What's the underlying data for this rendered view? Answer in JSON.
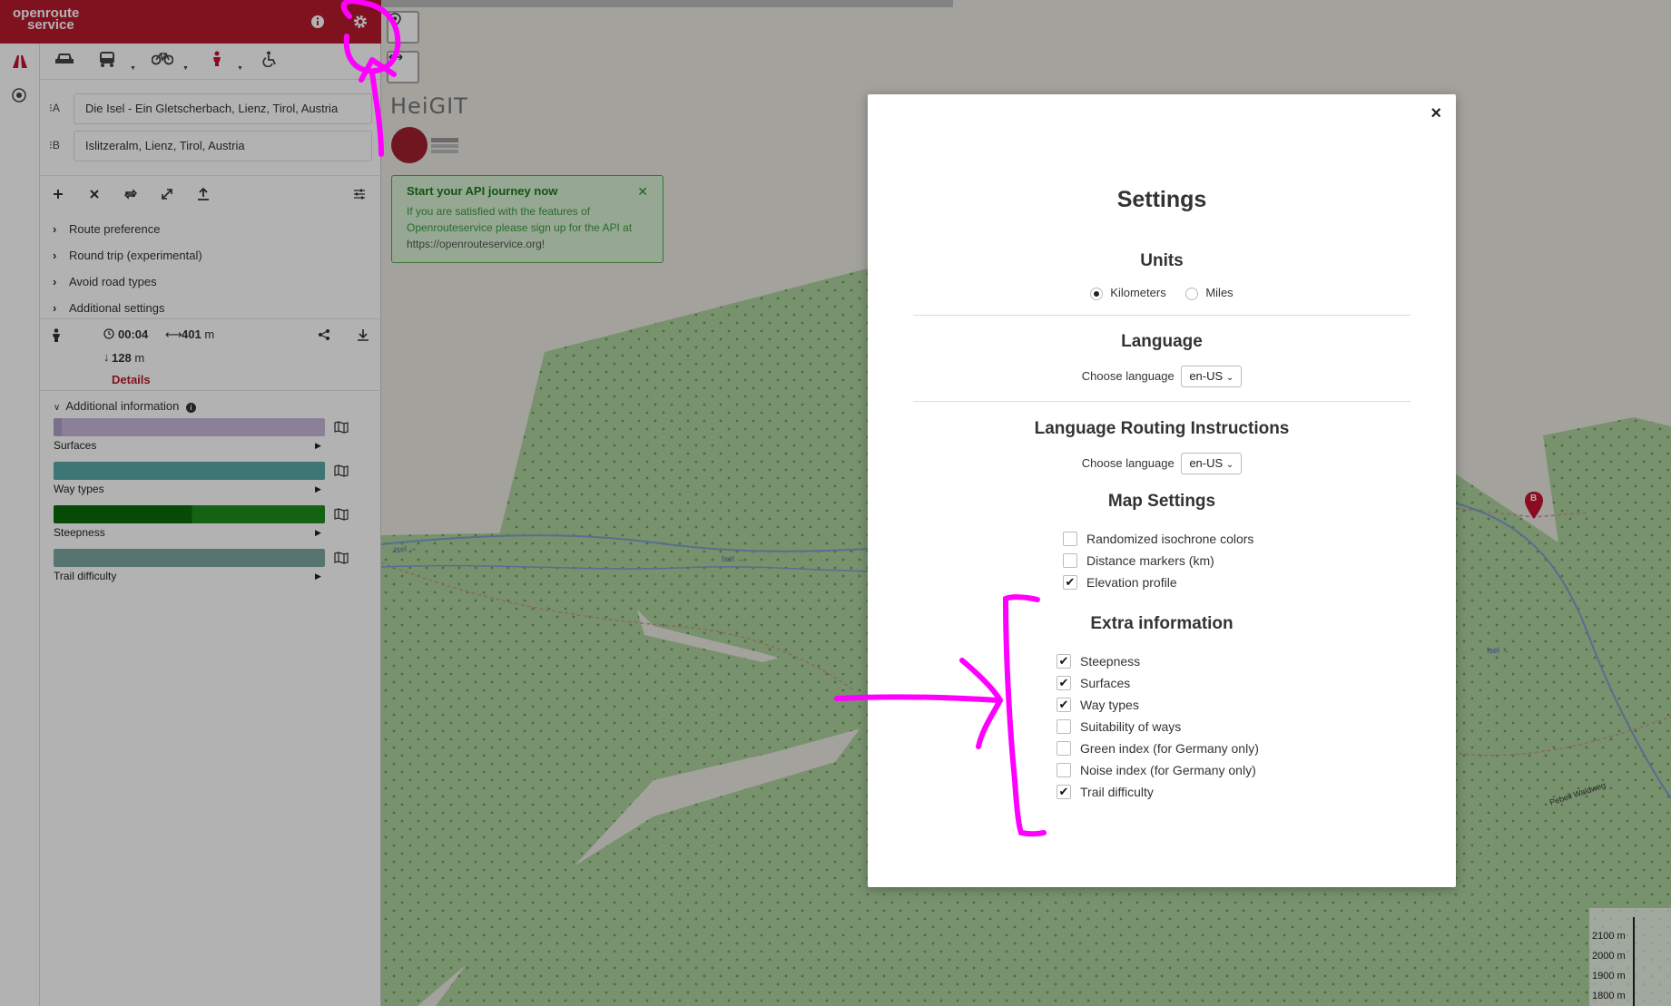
{
  "header": {
    "logo_line1": "openroute",
    "logo_line2": "service"
  },
  "profiles": [
    "car-icon",
    "truck-icon",
    "bicycle-icon",
    "walking-icon",
    "wheelchair-icon"
  ],
  "waypoints": [
    {
      "label": "A",
      "value": "Die Isel - Ein Gletscherbach, Lienz, Tirol, Austria"
    },
    {
      "label": "B",
      "value": "Islitzeralm, Lienz, Tirol, Austria"
    }
  ],
  "route_options": [
    "Route preference",
    "Round trip (experimental)",
    "Avoid road types",
    "Additional settings"
  ],
  "summary": {
    "duration": "00:04",
    "distance_value": "401",
    "distance_unit": "m",
    "descent_value": "128",
    "descent_unit": "m",
    "details_label": "Details"
  },
  "additional_info": {
    "title": "Additional information",
    "items": [
      {
        "label": "Surfaces",
        "color": "#c9b8dc"
      },
      {
        "label": "Way types",
        "color": "#5aa8a8"
      },
      {
        "label": "Steepness",
        "color": "#1d8f1d"
      },
      {
        "label": "Trail difficulty",
        "color": "#7fa6a3"
      }
    ]
  },
  "map": {
    "heigit": "HeiGIT",
    "api_box": {
      "title": "Start your API journey now",
      "body1": "If you are satisfied with the features of",
      "body2": "Openrouteservice please sign up for the API at",
      "body3": "https://openrouteservice.org!"
    },
    "elevation_legend": [
      "2100 m",
      "2000 m",
      "1900 m",
      "1800 m"
    ],
    "marker_b": "B",
    "labels": {
      "isel1": "Isel →",
      "isel2": "Isel →",
      "isel3": "Isel →",
      "path": "Pebell Waldweg"
    }
  },
  "settings": {
    "title": "Settings",
    "units": {
      "heading": "Units",
      "options": [
        "Kilometers",
        "Miles"
      ],
      "selected": "Kilometers"
    },
    "language": {
      "heading": "Language",
      "label": "Choose language",
      "value": "en-US"
    },
    "routing_language": {
      "heading": "Language Routing Instructions",
      "label": "Choose language",
      "value": "en-US"
    },
    "map_settings": {
      "heading": "Map Settings",
      "items": [
        {
          "label": "Randomized isochrone colors",
          "checked": false
        },
        {
          "label": "Distance markers (km)",
          "checked": false
        },
        {
          "label": "Elevation profile",
          "checked": true
        }
      ]
    },
    "extra_information": {
      "heading": "Extra information",
      "items": [
        {
          "label": "Steepness",
          "checked": true
        },
        {
          "label": "Surfaces",
          "checked": true
        },
        {
          "label": "Way types",
          "checked": true
        },
        {
          "label": "Suitability of ways",
          "checked": false
        },
        {
          "label": "Green index (for Germany only)",
          "checked": false
        },
        {
          "label": "Noise index (for Germany only)",
          "checked": false
        },
        {
          "label": "Trail difficulty",
          "checked": true
        }
      ]
    },
    "close_glyph": "×"
  }
}
